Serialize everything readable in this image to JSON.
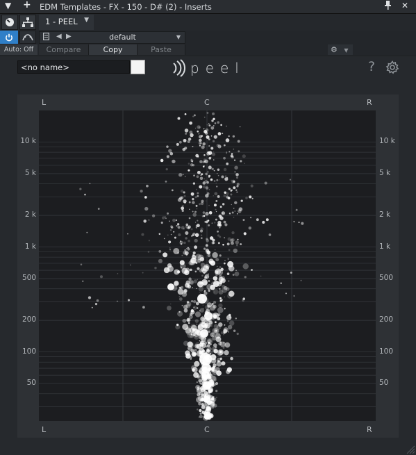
{
  "titlebar": {
    "title": "EDM Templates - FX - 150 - D# (2) - Inserts",
    "left_icons": [
      "menu-triangle-icon",
      "add-plus-icon"
    ],
    "right_icons": [
      "pin-icon",
      "close-icon"
    ]
  },
  "toolbar": {
    "plugin_tab": "1 - PEEL",
    "preset": "default",
    "auto_label": "Auto: Off",
    "compare": "Compare",
    "copy": "Copy",
    "paste": "Paste"
  },
  "plugin": {
    "name_field": "<no name>",
    "logo_text": "peel",
    "help": "?"
  },
  "scope": {
    "top_labels": [
      "L",
      "C",
      "R"
    ],
    "bottom_labels": [
      "L",
      "C",
      "R"
    ],
    "freq_labels_left": [
      "10 k",
      "5 k",
      "2 k",
      "1 k",
      "500",
      "200",
      "100",
      "50"
    ],
    "freq_labels_right": [
      "10 k",
      "5 k",
      "2 k",
      "1 k",
      "500",
      "200",
      "100",
      "50"
    ]
  }
}
